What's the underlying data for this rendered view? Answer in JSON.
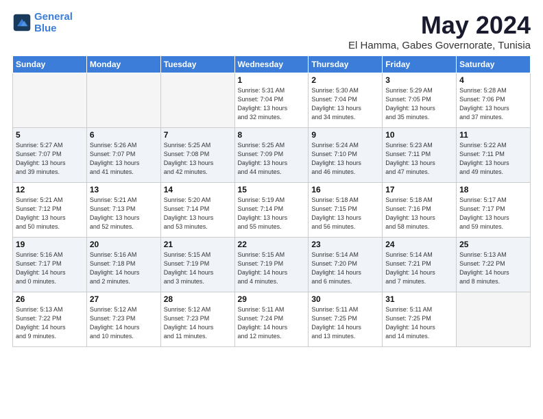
{
  "logo": {
    "line1": "General",
    "line2": "Blue"
  },
  "title": "May 2024",
  "subtitle": "El Hamma, Gabes Governorate, Tunisia",
  "days_of_week": [
    "Sunday",
    "Monday",
    "Tuesday",
    "Wednesday",
    "Thursday",
    "Friday",
    "Saturday"
  ],
  "weeks": [
    {
      "shade": false,
      "days": [
        {
          "num": "",
          "info": ""
        },
        {
          "num": "",
          "info": ""
        },
        {
          "num": "",
          "info": ""
        },
        {
          "num": "1",
          "info": "Sunrise: 5:31 AM\nSunset: 7:04 PM\nDaylight: 13 hours\nand 32 minutes."
        },
        {
          "num": "2",
          "info": "Sunrise: 5:30 AM\nSunset: 7:04 PM\nDaylight: 13 hours\nand 34 minutes."
        },
        {
          "num": "3",
          "info": "Sunrise: 5:29 AM\nSunset: 7:05 PM\nDaylight: 13 hours\nand 35 minutes."
        },
        {
          "num": "4",
          "info": "Sunrise: 5:28 AM\nSunset: 7:06 PM\nDaylight: 13 hours\nand 37 minutes."
        }
      ]
    },
    {
      "shade": true,
      "days": [
        {
          "num": "5",
          "info": "Sunrise: 5:27 AM\nSunset: 7:07 PM\nDaylight: 13 hours\nand 39 minutes."
        },
        {
          "num": "6",
          "info": "Sunrise: 5:26 AM\nSunset: 7:07 PM\nDaylight: 13 hours\nand 41 minutes."
        },
        {
          "num": "7",
          "info": "Sunrise: 5:25 AM\nSunset: 7:08 PM\nDaylight: 13 hours\nand 42 minutes."
        },
        {
          "num": "8",
          "info": "Sunrise: 5:25 AM\nSunset: 7:09 PM\nDaylight: 13 hours\nand 44 minutes."
        },
        {
          "num": "9",
          "info": "Sunrise: 5:24 AM\nSunset: 7:10 PM\nDaylight: 13 hours\nand 46 minutes."
        },
        {
          "num": "10",
          "info": "Sunrise: 5:23 AM\nSunset: 7:11 PM\nDaylight: 13 hours\nand 47 minutes."
        },
        {
          "num": "11",
          "info": "Sunrise: 5:22 AM\nSunset: 7:11 PM\nDaylight: 13 hours\nand 49 minutes."
        }
      ]
    },
    {
      "shade": false,
      "days": [
        {
          "num": "12",
          "info": "Sunrise: 5:21 AM\nSunset: 7:12 PM\nDaylight: 13 hours\nand 50 minutes."
        },
        {
          "num": "13",
          "info": "Sunrise: 5:21 AM\nSunset: 7:13 PM\nDaylight: 13 hours\nand 52 minutes."
        },
        {
          "num": "14",
          "info": "Sunrise: 5:20 AM\nSunset: 7:14 PM\nDaylight: 13 hours\nand 53 minutes."
        },
        {
          "num": "15",
          "info": "Sunrise: 5:19 AM\nSunset: 7:14 PM\nDaylight: 13 hours\nand 55 minutes."
        },
        {
          "num": "16",
          "info": "Sunrise: 5:18 AM\nSunset: 7:15 PM\nDaylight: 13 hours\nand 56 minutes."
        },
        {
          "num": "17",
          "info": "Sunrise: 5:18 AM\nSunset: 7:16 PM\nDaylight: 13 hours\nand 58 minutes."
        },
        {
          "num": "18",
          "info": "Sunrise: 5:17 AM\nSunset: 7:17 PM\nDaylight: 13 hours\nand 59 minutes."
        }
      ]
    },
    {
      "shade": true,
      "days": [
        {
          "num": "19",
          "info": "Sunrise: 5:16 AM\nSunset: 7:17 PM\nDaylight: 14 hours\nand 0 minutes."
        },
        {
          "num": "20",
          "info": "Sunrise: 5:16 AM\nSunset: 7:18 PM\nDaylight: 14 hours\nand 2 minutes."
        },
        {
          "num": "21",
          "info": "Sunrise: 5:15 AM\nSunset: 7:19 PM\nDaylight: 14 hours\nand 3 minutes."
        },
        {
          "num": "22",
          "info": "Sunrise: 5:15 AM\nSunset: 7:19 PM\nDaylight: 14 hours\nand 4 minutes."
        },
        {
          "num": "23",
          "info": "Sunrise: 5:14 AM\nSunset: 7:20 PM\nDaylight: 14 hours\nand 6 minutes."
        },
        {
          "num": "24",
          "info": "Sunrise: 5:14 AM\nSunset: 7:21 PM\nDaylight: 14 hours\nand 7 minutes."
        },
        {
          "num": "25",
          "info": "Sunrise: 5:13 AM\nSunset: 7:22 PM\nDaylight: 14 hours\nand 8 minutes."
        }
      ]
    },
    {
      "shade": false,
      "days": [
        {
          "num": "26",
          "info": "Sunrise: 5:13 AM\nSunset: 7:22 PM\nDaylight: 14 hours\nand 9 minutes."
        },
        {
          "num": "27",
          "info": "Sunrise: 5:12 AM\nSunset: 7:23 PM\nDaylight: 14 hours\nand 10 minutes."
        },
        {
          "num": "28",
          "info": "Sunrise: 5:12 AM\nSunset: 7:23 PM\nDaylight: 14 hours\nand 11 minutes."
        },
        {
          "num": "29",
          "info": "Sunrise: 5:11 AM\nSunset: 7:24 PM\nDaylight: 14 hours\nand 12 minutes."
        },
        {
          "num": "30",
          "info": "Sunrise: 5:11 AM\nSunset: 7:25 PM\nDaylight: 14 hours\nand 13 minutes."
        },
        {
          "num": "31",
          "info": "Sunrise: 5:11 AM\nSunset: 7:25 PM\nDaylight: 14 hours\nand 14 minutes."
        },
        {
          "num": "",
          "info": ""
        }
      ]
    }
  ]
}
